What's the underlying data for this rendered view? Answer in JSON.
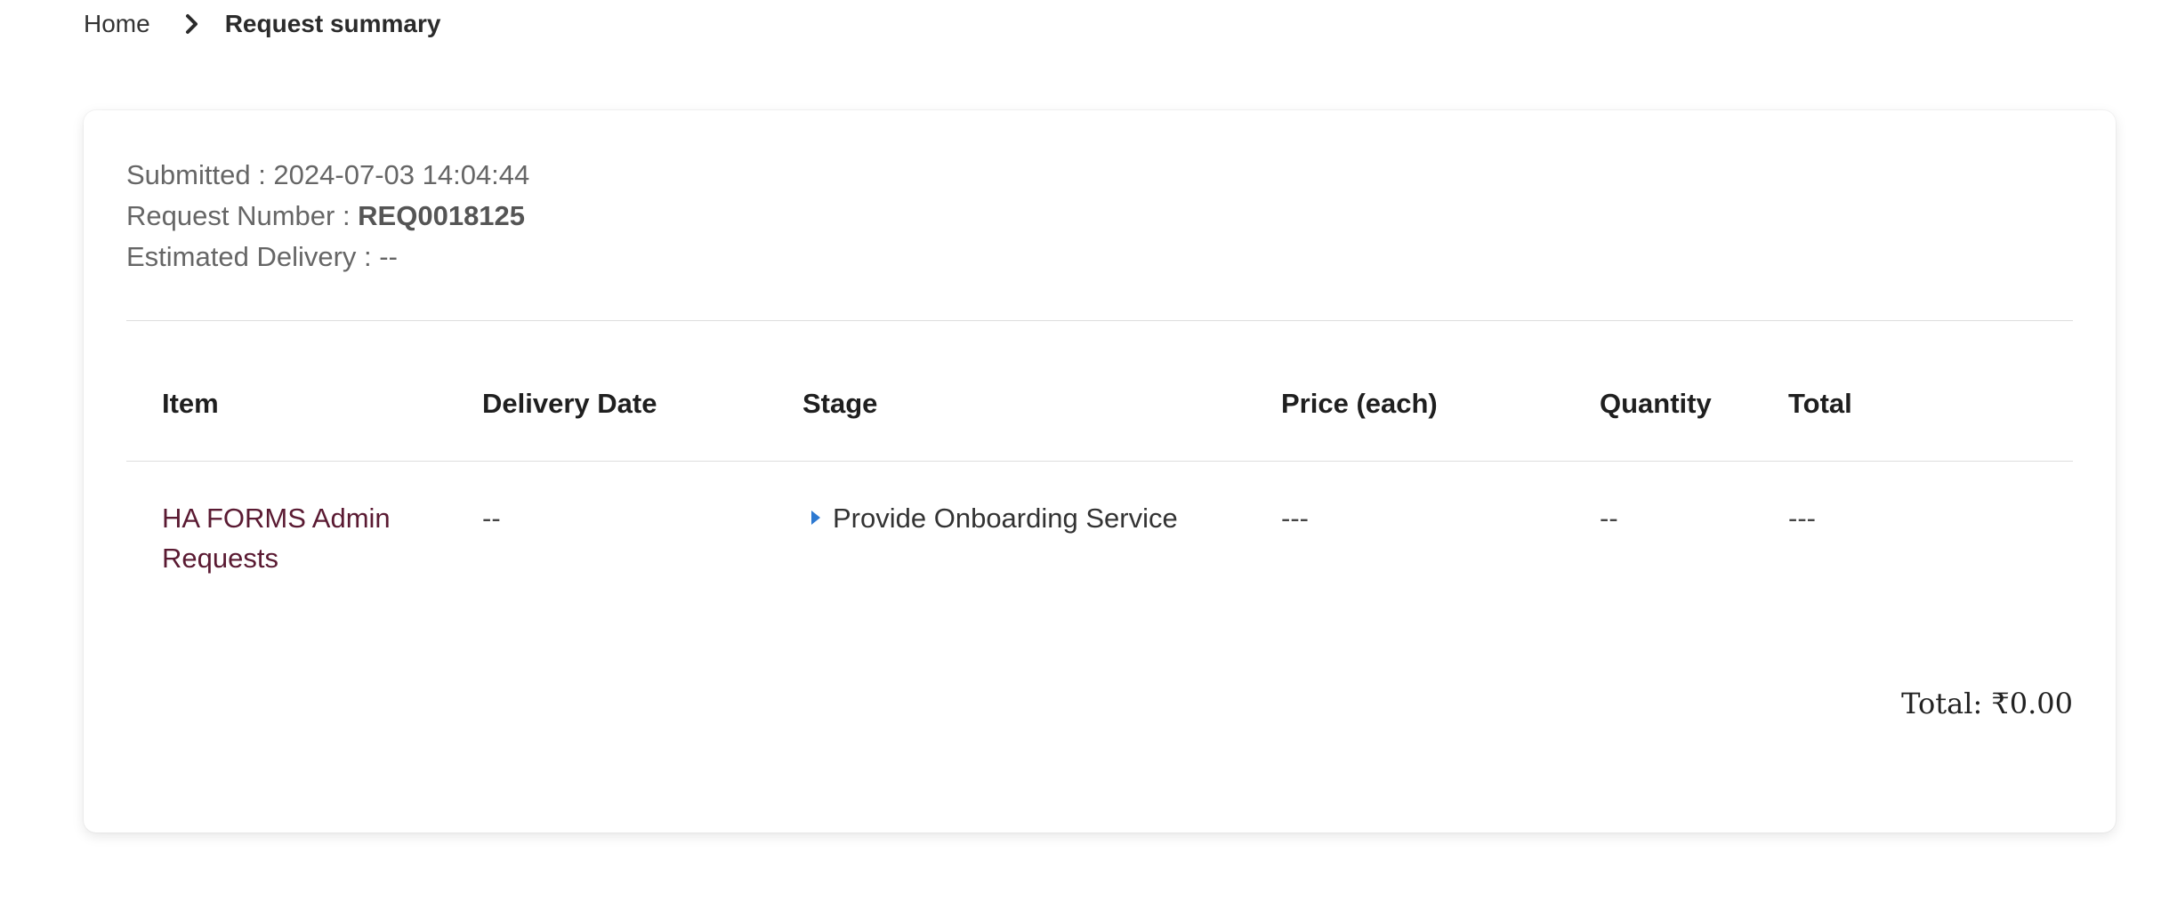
{
  "breadcrumb": {
    "home": "Home",
    "current": "Request summary",
    "separator_icon": "chevron-right-icon"
  },
  "meta": {
    "submitted_label": "Submitted : ",
    "submitted_value": "2024-07-03 14:04:44",
    "request_number_label": "Request Number : ",
    "request_number_value": "REQ0018125",
    "estimated_delivery_label": "Estimated Delivery : ",
    "estimated_delivery_value": "--"
  },
  "table": {
    "columns": [
      "Item",
      "Delivery Date",
      "Stage",
      "Price (each)",
      "Quantity",
      "Total"
    ],
    "rows": [
      {
        "item_line1": "HA FORMS Admin",
        "item_line2": "Requests",
        "delivery_date": "--",
        "stage": "Provide Onboarding Service",
        "price_each": "---",
        "quantity": "--",
        "total": "---"
      }
    ]
  },
  "summary": {
    "total_label": "Total: ",
    "total_value": "₹0.00"
  },
  "colors": {
    "item_link": "#5a1a32",
    "stage_icon": "#2d79d1",
    "divider": "#dedede"
  }
}
